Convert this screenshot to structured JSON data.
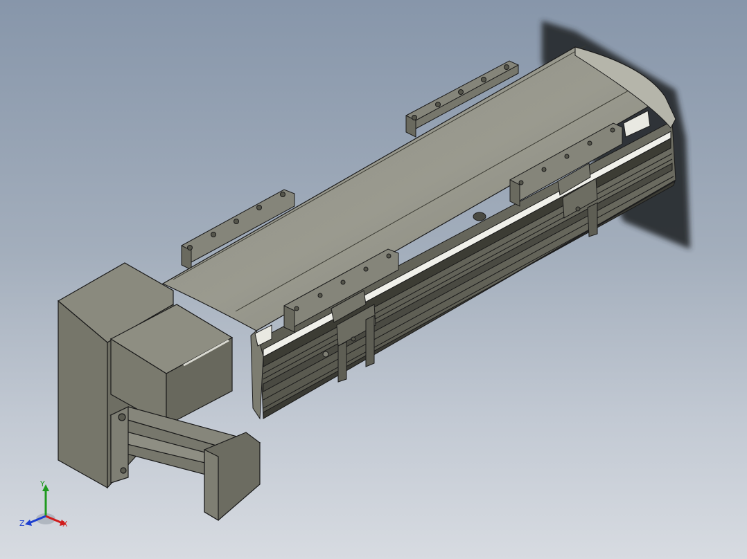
{
  "viewport": {
    "background_top": "#8796aa",
    "background_bottom": "#d7dbe1",
    "model_color": "#8a8a7c",
    "edge_color": "#1a1a1a"
  },
  "triad": {
    "x_label": "X",
    "y_label": "Y",
    "z_label": "Z",
    "x_color": "#d01b1b",
    "y_color": "#1f9a1f",
    "z_color": "#1d3fcf"
  }
}
